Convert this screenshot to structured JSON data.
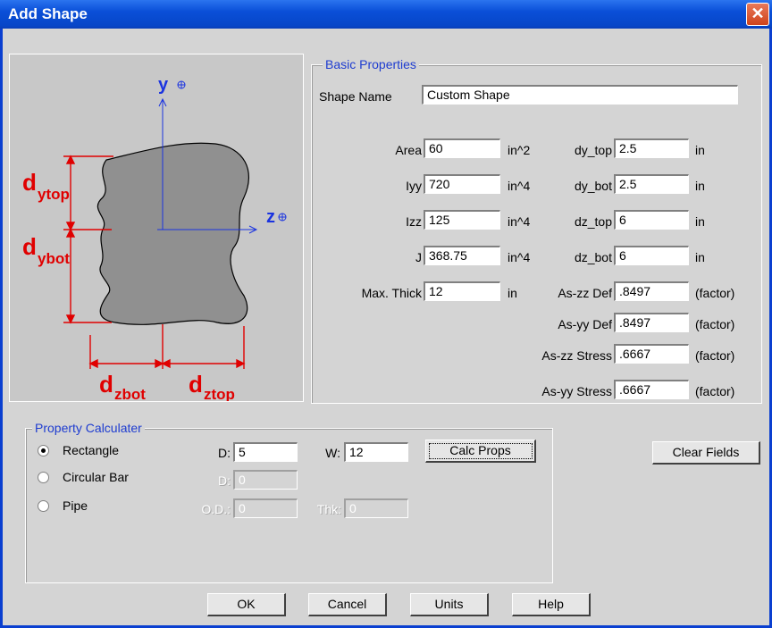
{
  "window": {
    "title": "Add Shape",
    "close_label": "✕"
  },
  "diagram": {
    "y_axis": "y",
    "z_axis": "z",
    "labels": {
      "dytop_main": "d",
      "dytop_sub": "ytop",
      "dybot_main": "d",
      "dybot_sub": "ybot",
      "dzbot_main": "d",
      "dzbot_sub": "zbot",
      "dztop_main": "d",
      "dztop_sub": "ztop"
    }
  },
  "basic": {
    "legend": "Basic Properties",
    "shape_name_label": "Shape Name",
    "shape_name_value": "Custom Shape",
    "rows": [
      {
        "label": "Area",
        "value": "60",
        "unit": "in^2",
        "label2": "dy_top",
        "value2": "2.5",
        "unit2": "in"
      },
      {
        "label": "Iyy",
        "value": "720",
        "unit": "in^4",
        "label2": "dy_bot",
        "value2": "2.5",
        "unit2": "in"
      },
      {
        "label": "Izz",
        "value": "125",
        "unit": "in^4",
        "label2": "dz_top",
        "value2": "6",
        "unit2": "in"
      },
      {
        "label": "J",
        "value": "368.75",
        "unit": "in^4",
        "label2": "dz_bot",
        "value2": "6",
        "unit2": "in"
      },
      {
        "label": "Max. Thick",
        "value": "12",
        "unit": "in",
        "label2": "As-zz Def",
        "value2": ".8497",
        "unit2": "(factor)"
      }
    ],
    "extra_rows": [
      {
        "label": "As-yy Def",
        "value": ".8497",
        "unit": "(factor)"
      },
      {
        "label": "As-zz Stress",
        "value": ".6667",
        "unit": "(factor)"
      },
      {
        "label": "As-yy Stress",
        "value": ".6667",
        "unit": "(factor)"
      }
    ]
  },
  "calc": {
    "legend": "Property Calculater",
    "rectangle_label": "Rectangle",
    "circular_label": "Circular Bar",
    "pipe_label": "Pipe",
    "selected": "Rectangle",
    "d_label": "D:",
    "d_value": "5",
    "w_label": "W:",
    "w_value": "12",
    "calc_button": "Calc Props",
    "circ_d_label": "D:",
    "circ_d_value": "0",
    "od_label": "O.D.:",
    "od_value": "0",
    "thk_label": "Thk:",
    "thk_value": "0"
  },
  "buttons": {
    "clear": "Clear Fields",
    "ok": "OK",
    "cancel": "Cancel",
    "units": "Units",
    "help": "Help"
  }
}
